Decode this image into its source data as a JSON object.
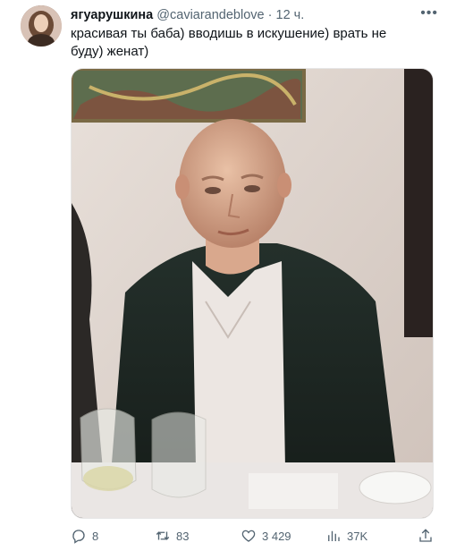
{
  "tweet": {
    "display_name": "ягуарушкина",
    "handle": "@caviarandeblove",
    "separator": "·",
    "time": "12 ч.",
    "more_icon": "•••",
    "text": "красивая ты баба) вводишь в искушение) врать не буду) женат)",
    "media_icon": "photo",
    "stats": {
      "replies": "8",
      "retweets": "83",
      "likes": "3 429",
      "views": "37K"
    },
    "colors": {
      "text": "#0f1419",
      "secondary": "#536471",
      "background": "#ffffff"
    }
  }
}
